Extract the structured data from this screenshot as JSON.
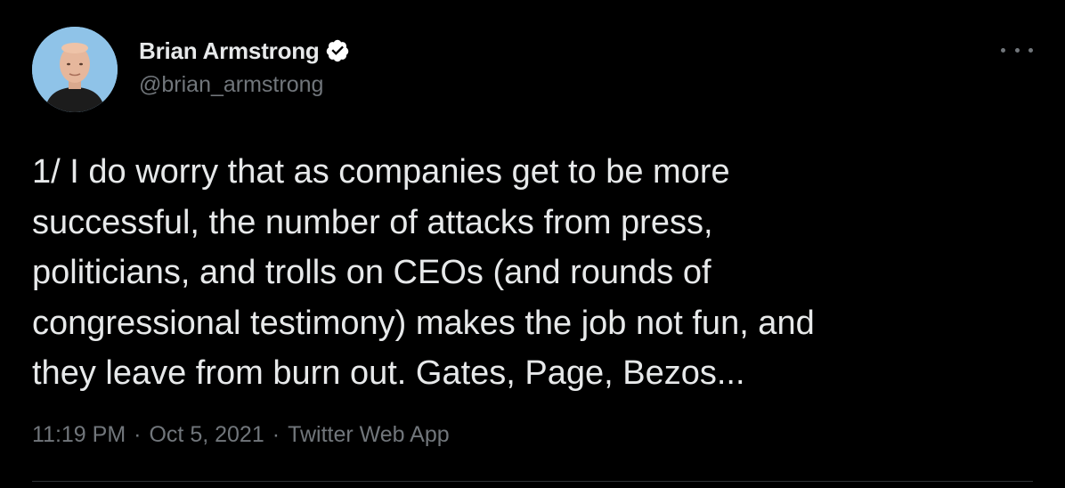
{
  "author": {
    "display_name": "Brian Armstrong",
    "handle": "@brian_armstrong",
    "verified": true
  },
  "tweet": {
    "text_lines": [
      "1/ I do worry that as companies get to be more",
      "successful, the number of attacks from press,",
      "politicians, and trolls on CEOs (and rounds of",
      "congressional testimony) makes the job not fun, and",
      "they leave from burn out. Gates, Page, Bezos..."
    ],
    "time": "11:19 PM",
    "date": "Oct 5, 2021",
    "source": "Twitter Web App",
    "separator": "·"
  },
  "icons": {
    "verified": "verified-badge-icon",
    "more": "more-options-icon"
  },
  "colors": {
    "background": "#000000",
    "text_primary": "#e7e9ea",
    "text_secondary": "#71767b",
    "verified_badge": "#ffffff"
  }
}
